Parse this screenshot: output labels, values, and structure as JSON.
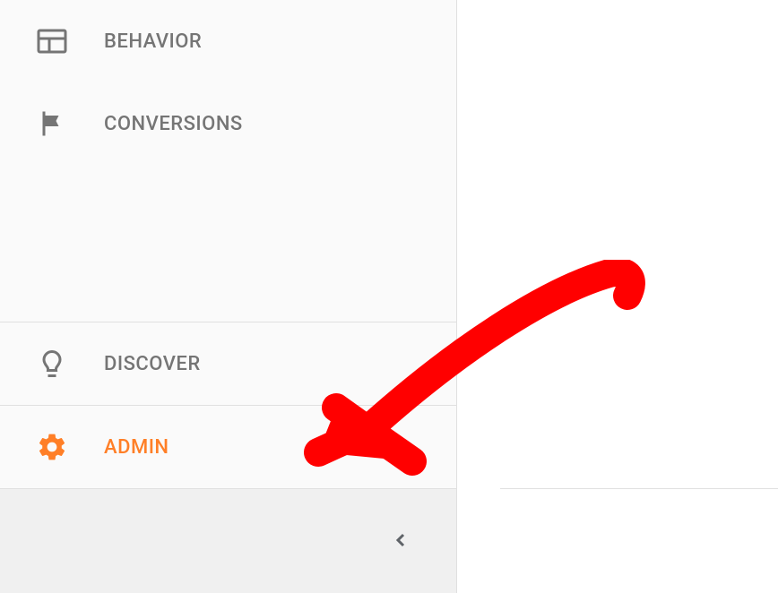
{
  "sidebar": {
    "items": [
      {
        "label": "BEHAVIOR",
        "icon": "behavior"
      },
      {
        "label": "CONVERSIONS",
        "icon": "flag"
      }
    ],
    "bottom": [
      {
        "label": "DISCOVER",
        "icon": "bulb",
        "active": false
      },
      {
        "label": "ADMIN",
        "icon": "gear",
        "active": true
      }
    ]
  },
  "annotation": {
    "type": "arrow",
    "color": "#ff0000"
  }
}
